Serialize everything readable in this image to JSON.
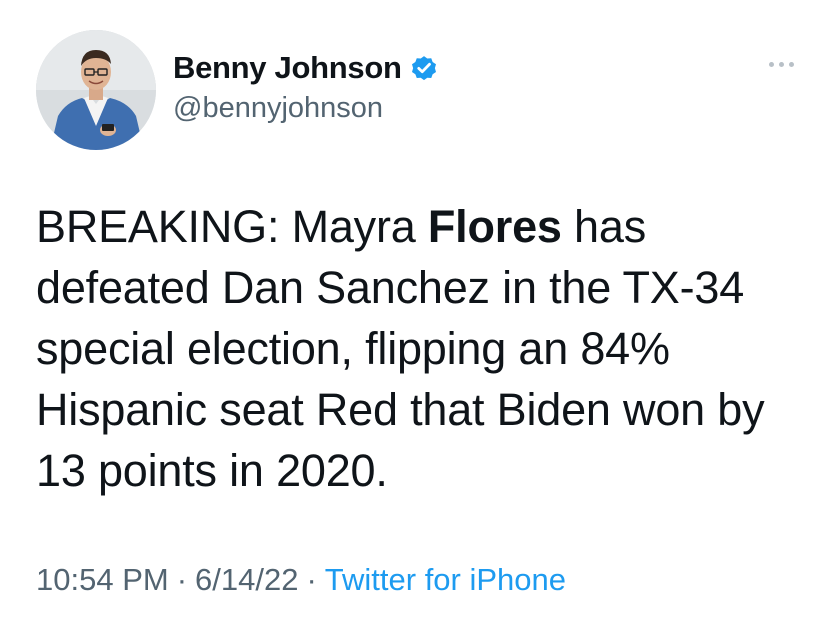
{
  "author": {
    "display_name": "Benny Johnson",
    "handle": "@bennyjohnson",
    "verified": true,
    "verified_color": "#1d9bf0"
  },
  "tweet": {
    "text_before": "BREAKING: Mayra ",
    "text_bold": "Flores",
    "text_after": " has defeated Dan Sanchez in the TX-34 special election, flipping an 84% Hispanic seat Red that Biden won by 13 points in 2020."
  },
  "meta": {
    "time": "10:54 PM",
    "separator": "·",
    "date": "6/14/22",
    "source": "Twitter for iPhone",
    "source_color": "#1d9bf0"
  },
  "icons": {
    "more": "more-horizontal-icon",
    "verified": "verified-badge-icon"
  }
}
